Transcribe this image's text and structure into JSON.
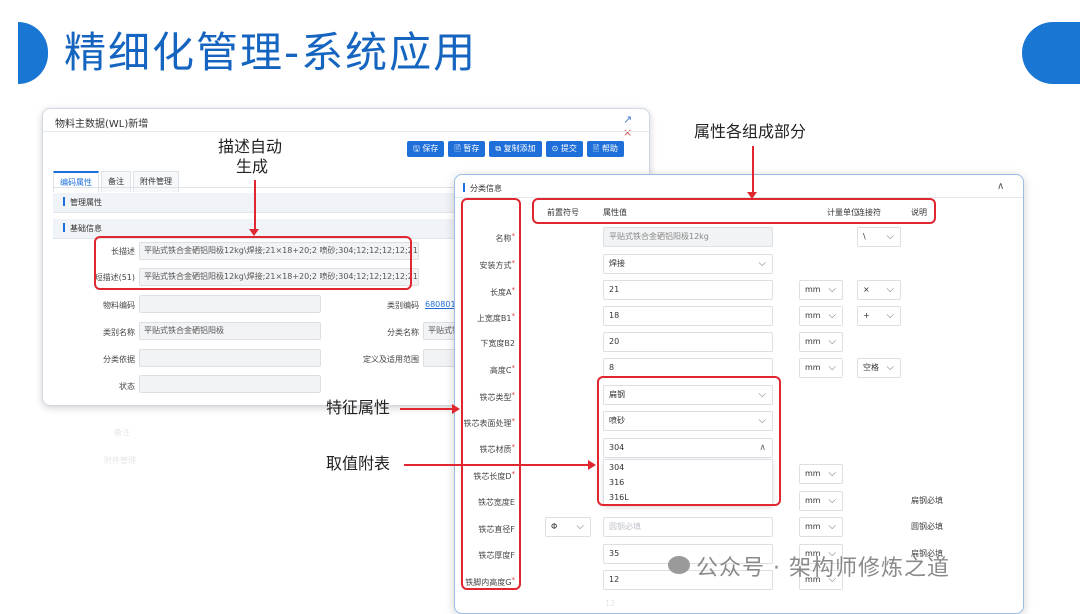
{
  "slide": {
    "title": "精细化管理-系统应用"
  },
  "win1": {
    "title": "物料主数据(WL)新增",
    "window_controls": [
      "↗",
      "×"
    ],
    "toolbar": [
      "🖫 保存",
      "🖹 暂存",
      "⧉ 复制添加",
      "⊙ 提交",
      "🖹 帮助"
    ],
    "tabs": [
      "编码属性",
      "备注",
      "附件管理"
    ],
    "sections": [
      "管理属性",
      "基础信息"
    ],
    "fields": {
      "long_desc_label": "长描述",
      "long_desc_value": "平贴式铁合金硒铝阳极12kg\\焊接;21×18+20;2 喷砂;304;12;12;12;12;212",
      "short_desc_label": "短描述(51)",
      "short_desc_value": "平贴式铁合金硒铝阳极12kg\\焊接;21×18+20;2 喷砂;304;12;12;12;12;212",
      "material_code_label": "物料编码",
      "category_code_label": "类别编码",
      "category_code_value": "680801",
      "category_name_label": "类别名称",
      "category_name_value": "平贴式铁合金硒铝阳极",
      "class_name_label": "分类名称",
      "class_name_value": "平贴式铁",
      "class_basis_label": "分类依据",
      "def_scope_label": "定义及适用范围",
      "status_label": "状态"
    },
    "ghost": [
      "备注",
      "附件管理"
    ]
  },
  "win2": {
    "title": "分类信息",
    "collapse_icon": "∧",
    "columns": [
      "前置符号",
      "属性值",
      "计量单位",
      "连接符",
      "说明"
    ],
    "rows": [
      {
        "label": "名称",
        "value": "平贴式铁合金硒铝阳极12kg",
        "unit": "",
        "connector": "\\",
        "note": ""
      },
      {
        "label": "安装方式",
        "value": "焊接",
        "unit": "",
        "connector": "",
        "note": ""
      },
      {
        "label": "长度A",
        "value": "21",
        "unit": "mm",
        "connector": "×",
        "note": ""
      },
      {
        "label": "上宽度B1",
        "value": "18",
        "unit": "mm",
        "connector": "+",
        "note": ""
      },
      {
        "label": "下宽度B2",
        "value": "20",
        "unit": "mm",
        "connector": "",
        "note": ""
      },
      {
        "label": "高度C",
        "value": "8",
        "unit": "mm",
        "connector": "空格",
        "note": ""
      },
      {
        "label": "铁芯类型",
        "value": "扁钢",
        "unit": "",
        "connector": "",
        "note": ""
      },
      {
        "label": "铁芯表面处理",
        "value": "喷砂",
        "unit": "",
        "connector": "",
        "note": ""
      },
      {
        "label": "铁芯材质",
        "value": "304",
        "unit": "",
        "connector": "",
        "note": ""
      },
      {
        "label": "铁芯长度D",
        "value": "",
        "unit": "mm",
        "connector": "",
        "note": ""
      },
      {
        "label": "铁芯宽度E",
        "value": "",
        "unit": "mm",
        "connector": "",
        "note": "扁钢必填"
      },
      {
        "label": "铁芯直径F",
        "value": "圆钢必填",
        "unit": "mm",
        "connector": "",
        "note": "圆钢必填",
        "prefix": "Φ"
      },
      {
        "label": "铁芯厚度F",
        "value": "35",
        "unit": "mm",
        "connector": "",
        "note": "扁钢必填"
      },
      {
        "label": "铁脚内高度G",
        "value": "12",
        "unit": "mm",
        "connector": "",
        "note": ""
      }
    ],
    "dropdown_options": [
      "304",
      "316",
      "316L"
    ],
    "ghost_value": "12"
  },
  "annotations": {
    "auto_desc": "描述自动\n生成",
    "auto_desc_line1": "描述自动",
    "auto_desc_line2": "生成",
    "attr_parts": "属性各组成部分",
    "feature_attr": "特征属性",
    "value_table": "取值附表"
  },
  "watermark": "公众号 · 架构师修炼之道",
  "colors": {
    "accent": "#1976d2",
    "annotation_red": "#e0262e",
    "button_blue": "#1e6fd9"
  }
}
